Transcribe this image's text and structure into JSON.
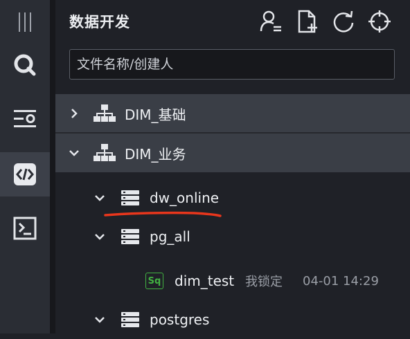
{
  "colors": {
    "rail_bg": "#2a2d34",
    "panel_bg": "#1f2127",
    "group_row_bg": "#3a3e46",
    "sql_badge": "#42b342",
    "annotation_underline": "#e8361c"
  },
  "rail": {
    "items": [
      {
        "name": "menu-handle-icon"
      },
      {
        "name": "search-icon"
      },
      {
        "name": "list-settings-icon"
      },
      {
        "name": "code-icon",
        "active": true
      },
      {
        "name": "terminal-icon"
      }
    ]
  },
  "panel": {
    "title": "数据开发",
    "tools": [
      "user-filter-icon",
      "new-file-icon",
      "refresh-icon",
      "locate-icon"
    ]
  },
  "search": {
    "placeholder": "文件名称/创建人"
  },
  "tree": {
    "groups": [
      {
        "label": "DIM_基础",
        "expanded": false,
        "icon": "hierarchy-icon"
      },
      {
        "label": "DIM_业务",
        "expanded": true,
        "icon": "hierarchy-icon"
      }
    ],
    "databases": [
      {
        "label": "dw_online",
        "expanded": true,
        "icon": "database-icon"
      },
      {
        "label": "pg_all",
        "expanded": true,
        "icon": "database-icon"
      },
      {
        "label": "postgres",
        "expanded": true,
        "icon": "database-icon"
      }
    ],
    "files": [
      {
        "badge": "Sq",
        "label": "dim_test",
        "lock_status": "我锁定",
        "time": "04-01 14:29"
      }
    ]
  }
}
